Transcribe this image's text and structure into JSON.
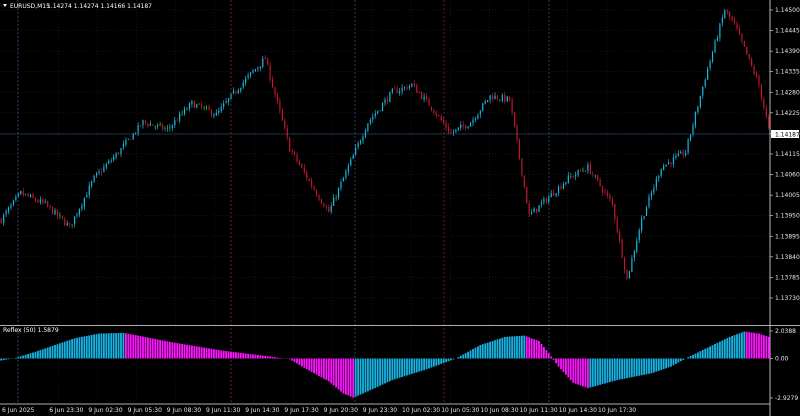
{
  "header": {
    "dropdown_icon": "triangle-down-icon",
    "symbol": "EURUSD,M15",
    "ohlc": "1.14274 1.14274 1.14166 1.14187"
  },
  "price_axis": {
    "ticks": [
      "1.14500",
      "1.14445",
      "1.14390",
      "1.14335",
      "1.14280",
      "1.14225",
      "1.14170",
      "1.14115",
      "1.14060",
      "1.14005",
      "1.13950",
      "1.13895",
      "1.13840",
      "1.13785",
      "1.13730"
    ],
    "current_price": "1.14187"
  },
  "time_axis": {
    "labels": [
      "6 Jun 2025",
      "6 Jun 23:30",
      "9 Jun 02:30",
      "9 Jun 05:30",
      "9 Jun 08:30",
      "9 Jun 11:30",
      "9 Jun 14:30",
      "9 Jun 17:30",
      "9 Jun 20:30",
      "9 Jun 23:30",
      "10 Jun 02:30",
      "10 Jun 05:30",
      "10 Jun 08:30",
      "10 Jun 11:30",
      "10 Jun 14:30",
      "10 Jun 17:30"
    ]
  },
  "indicator": {
    "title": "Reflex (50) 1.5879",
    "ticks": [
      "2.0388",
      "0.00",
      "-2.9279"
    ],
    "ylim": [
      -2.9279,
      2.0388
    ]
  },
  "colors": {
    "background": "#000000",
    "grid": "#1c2a44",
    "bull_candle": "#19b8e0",
    "bear_candle": "#c2182f",
    "doji_candle": "#3cc24a",
    "separator": "#8a2a36",
    "separator_alt": "#3a5b8a",
    "hist_pos": "#16b4e4",
    "hist_neg": "#ff14ff",
    "price_line": "#3a5b8a"
  },
  "chart_data": {
    "type": "candlestick",
    "ylim": [
      1.1373,
      1.145
    ],
    "approximate_close_path": [
      [
        0,
        1.1394
      ],
      [
        8,
        1.1401
      ],
      [
        18,
        1.1398
      ],
      [
        28,
        1.1392
      ],
      [
        38,
        1.1405
      ],
      [
        48,
        1.1412
      ],
      [
        58,
        1.142
      ],
      [
        68,
        1.1418
      ],
      [
        78,
        1.1425
      ],
      [
        88,
        1.1422
      ],
      [
        98,
        1.143
      ],
      [
        108,
        1.1437
      ],
      [
        118,
        1.1413
      ],
      [
        128,
        1.1402
      ],
      [
        134,
        1.1396
      ],
      [
        142,
        1.1408
      ],
      [
        150,
        1.142
      ],
      [
        160,
        1.1428
      ],
      [
        168,
        1.143
      ],
      [
        176,
        1.1424
      ],
      [
        184,
        1.1417
      ],
      [
        192,
        1.142
      ],
      [
        200,
        1.1427
      ],
      [
        208,
        1.1426
      ],
      [
        216,
        1.1395
      ],
      [
        224,
        1.14
      ],
      [
        232,
        1.1405
      ],
      [
        240,
        1.1408
      ],
      [
        250,
        1.1398
      ],
      [
        256,
        1.1378
      ],
      [
        262,
        1.1394
      ],
      [
        270,
        1.1408
      ],
      [
        280,
        1.1412
      ],
      [
        288,
        1.1432
      ],
      [
        296,
        1.145
      ],
      [
        300,
        1.1446
      ],
      [
        305,
        1.1438
      ],
      [
        310,
        1.143
      ],
      [
        314,
        1.1418
      ]
    ],
    "reflex_histogram": {
      "ylim": [
        -2.9279,
        2.0388
      ],
      "approximate_values": [
        [
          0,
          -0.15
        ],
        [
          6,
          0.05
        ],
        [
          14,
          0.5
        ],
        [
          22,
          1.0
        ],
        [
          30,
          1.5
        ],
        [
          40,
          1.85
        ],
        [
          50,
          1.9
        ],
        [
          56,
          1.7
        ],
        [
          70,
          1.2
        ],
        [
          90,
          0.6
        ],
        [
          112,
          0.1
        ],
        [
          118,
          -0.05
        ],
        [
          126,
          -0.9
        ],
        [
          134,
          -1.7
        ],
        [
          140,
          -2.6
        ],
        [
          144,
          -2.9
        ],
        [
          148,
          -2.6
        ],
        [
          160,
          -1.6
        ],
        [
          174,
          -0.8
        ],
        [
          186,
          0.0
        ],
        [
          196,
          1.0
        ],
        [
          206,
          1.6
        ],
        [
          214,
          1.7
        ],
        [
          220,
          1.3
        ],
        [
          224,
          0.4
        ],
        [
          228,
          -0.6
        ],
        [
          234,
          -1.8
        ],
        [
          240,
          -2.2
        ],
        [
          252,
          -1.6
        ],
        [
          266,
          -1.1
        ],
        [
          274,
          -0.6
        ],
        [
          280,
          0.0
        ],
        [
          290,
          0.9
        ],
        [
          298,
          1.6
        ],
        [
          304,
          2.0
        ],
        [
          310,
          1.85
        ],
        [
          314,
          1.6
        ]
      ]
    }
  }
}
